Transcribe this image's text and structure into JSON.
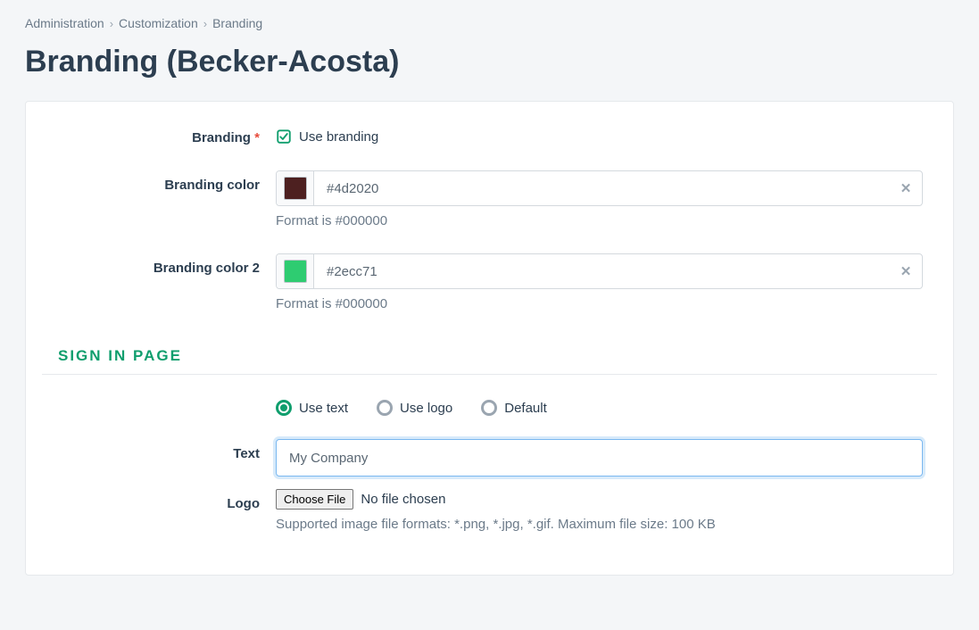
{
  "breadcrumb": {
    "items": [
      "Administration",
      "Customization",
      "Branding"
    ]
  },
  "page_title": "Branding (Becker-Acosta)",
  "fields": {
    "branding_label": "Branding",
    "branding_required_mark": "*",
    "use_branding_label": "Use branding",
    "branding_color_label": "Branding color",
    "branding_color_value": "#4d2020",
    "branding_color_swatch": "#4d2020",
    "branding_color_help": "Format is #000000",
    "branding_color2_label": "Branding color 2",
    "branding_color2_value": "#2ecc71",
    "branding_color2_swatch": "#2ecc71",
    "branding_color2_help": "Format is #000000"
  },
  "section": {
    "title": "SIGN IN PAGE",
    "radio": {
      "use_text": "Use text",
      "use_logo": "Use logo",
      "default": "Default",
      "selected": "use_text"
    },
    "text_label": "Text",
    "text_value": "My Company",
    "logo_label": "Logo",
    "choose_file": "Choose File",
    "no_file_chosen": "No file chosen",
    "logo_help": "Supported image file formats: *.png, *.jpg, *.gif. Maximum file size: 100 KB"
  },
  "colors": {
    "accent": "#0f9e6d"
  }
}
